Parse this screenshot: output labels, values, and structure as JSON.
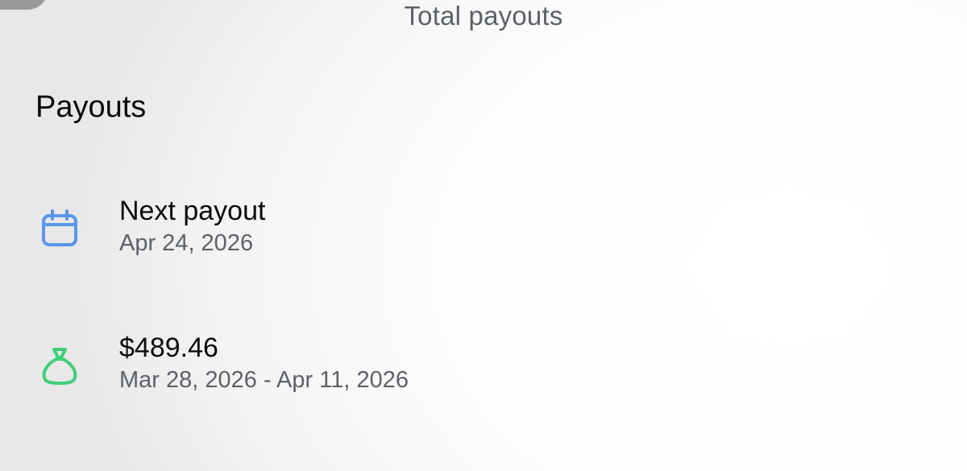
{
  "header": {
    "title": "Total payouts"
  },
  "payouts": {
    "heading": "Payouts",
    "next_payout": {
      "icon": "calendar-icon",
      "icon_color": "#5b96e8",
      "label": "Next payout",
      "date": "Apr 24, 2026"
    },
    "last_payout": {
      "icon": "money-bag-icon",
      "icon_color": "#3ecf78",
      "amount": "$489.46",
      "period": "Mar 28, 2026 - Apr 11, 2026"
    }
  }
}
